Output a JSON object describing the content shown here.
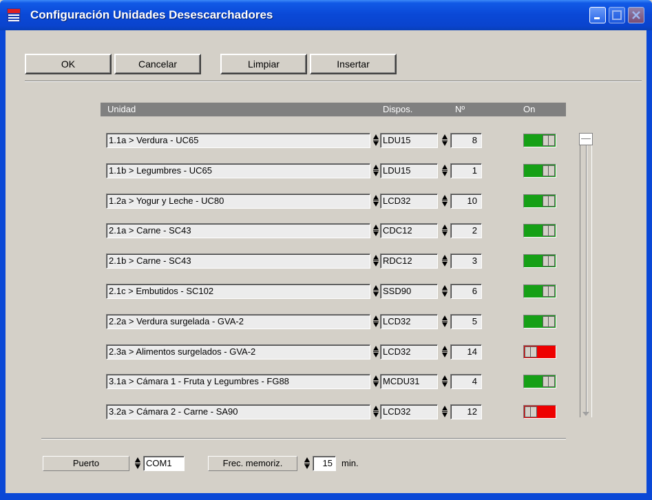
{
  "window": {
    "title": "Configuración Unidades Desescarchadores"
  },
  "toolbar": {
    "ok_label": "OK",
    "cancel_label": "Cancelar",
    "clear_label": "Limpiar",
    "insert_label": "Insertar"
  },
  "table": {
    "headers": {
      "unit": "Unidad",
      "device": "Dispos.",
      "number": "Nº",
      "on": "On"
    },
    "rows": [
      {
        "unit": "1.1a > Verdura - UC65",
        "device": "LDU15",
        "number": "8",
        "on": true
      },
      {
        "unit": "1.1b > Legumbres - UC65",
        "device": "LDU15",
        "number": "1",
        "on": true
      },
      {
        "unit": "1.2a > Yogur y Leche - UC80",
        "device": "LCD32",
        "number": "10",
        "on": true
      },
      {
        "unit": "2.1a > Carne - SC43",
        "device": "CDC12",
        "number": "2",
        "on": true
      },
      {
        "unit": "2.1b > Carne - SC43",
        "device": "RDC12",
        "number": "3",
        "on": true
      },
      {
        "unit": "2.1c > Embutidos - SC102",
        "device": "SSD90",
        "number": "6",
        "on": true
      },
      {
        "unit": "2.2a > Verdura surgelada - GVA-2",
        "device": "LCD32",
        "number": "5",
        "on": true
      },
      {
        "unit": "2.3a > Alimentos surgelados - GVA-2",
        "device": "LCD32",
        "number": "14",
        "on": false
      },
      {
        "unit": "3.1a > Cámara 1 - Fruta y Legumbres - FG88",
        "device": "MCDU31",
        "number": "4",
        "on": true
      },
      {
        "unit": "3.2a > Cámara 2 - Carne - SA90",
        "device": "LCD32",
        "number": "12",
        "on": false
      }
    ]
  },
  "footer": {
    "port_label": "Puerto",
    "port_value": "COM1",
    "freq_label": "Frec. memoriz.",
    "freq_value": "15",
    "freq_unit": "min."
  },
  "colors": {
    "titlebar": "#0a48d6",
    "toggle_on": "#16a016",
    "toggle_off": "#ee0000",
    "header_bg": "#808080"
  },
  "icons": {
    "app": "app-icon",
    "minimize": "minimize-icon",
    "maximize": "maximize-icon",
    "close": "close-icon",
    "spinner": "spinner-icon"
  }
}
